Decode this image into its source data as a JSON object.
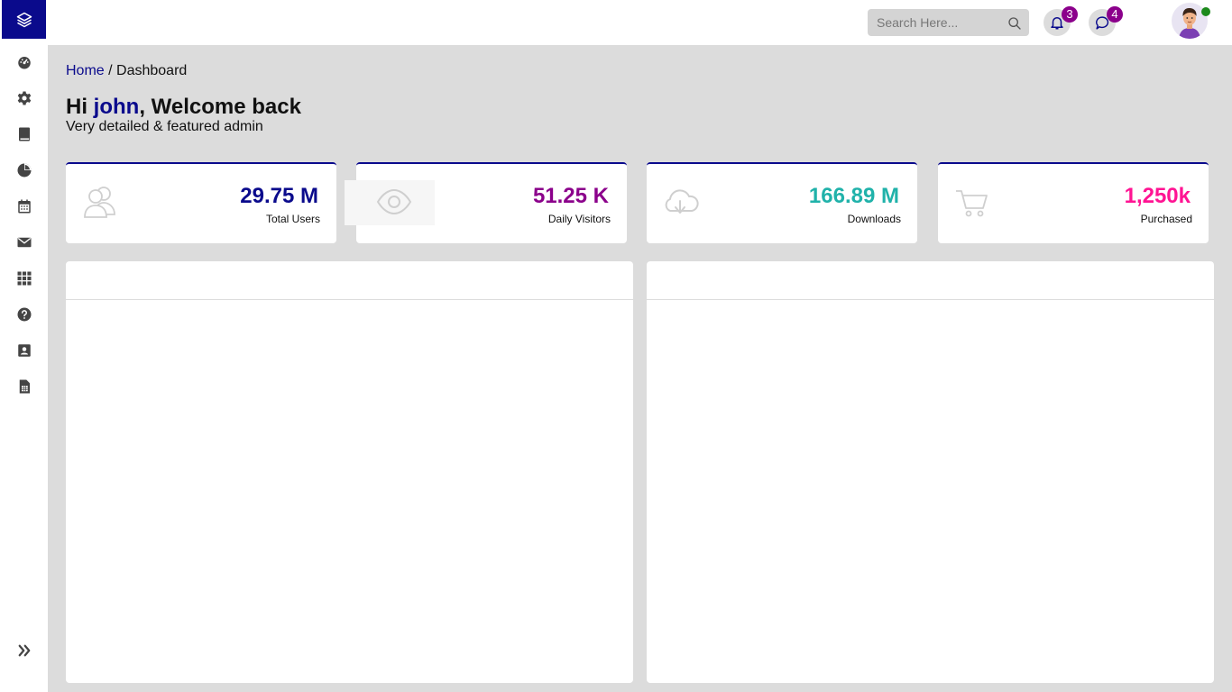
{
  "header": {
    "search_placeholder": "Search Here...",
    "notifications_count": "3",
    "messages_count": "4"
  },
  "sidebar": {
    "items": [
      {
        "icon": "dashboard-gauge-icon"
      },
      {
        "icon": "gear-icon"
      },
      {
        "icon": "book-icon"
      },
      {
        "icon": "pie-chart-icon"
      },
      {
        "icon": "calendar-icon"
      },
      {
        "icon": "envelope-icon"
      },
      {
        "icon": "grid-icon"
      },
      {
        "icon": "help-icon"
      },
      {
        "icon": "contact-card-icon"
      },
      {
        "icon": "spreadsheet-icon"
      }
    ],
    "expand_icon": "double-chevron-right-icon"
  },
  "breadcrumb": {
    "home": "Home",
    "separator": " / ",
    "current": "Dashboard"
  },
  "welcome": {
    "greeting": "Hi ",
    "name": "john",
    "rest": ", Welcome back",
    "subtitle": "Very detailed & featured admin"
  },
  "stats": [
    {
      "value": "29.75 M",
      "label": "Total Users",
      "color": "#0a0a8c",
      "icon": "users-icon"
    },
    {
      "value": "51.25 K",
      "label": "Daily Visitors",
      "color": "#8b008b",
      "icon": "eye-icon"
    },
    {
      "value": "166.89 M",
      "label": "Downloads",
      "color": "#20b2aa",
      "icon": "cloud-download-icon"
    },
    {
      "value": "1,250k",
      "label": "Purchased",
      "color": "#ff1493",
      "icon": "cart-icon"
    }
  ],
  "colors": {
    "brand": "#0a0a8c",
    "badge": "#8b008b",
    "online": "#1c8a1c"
  }
}
